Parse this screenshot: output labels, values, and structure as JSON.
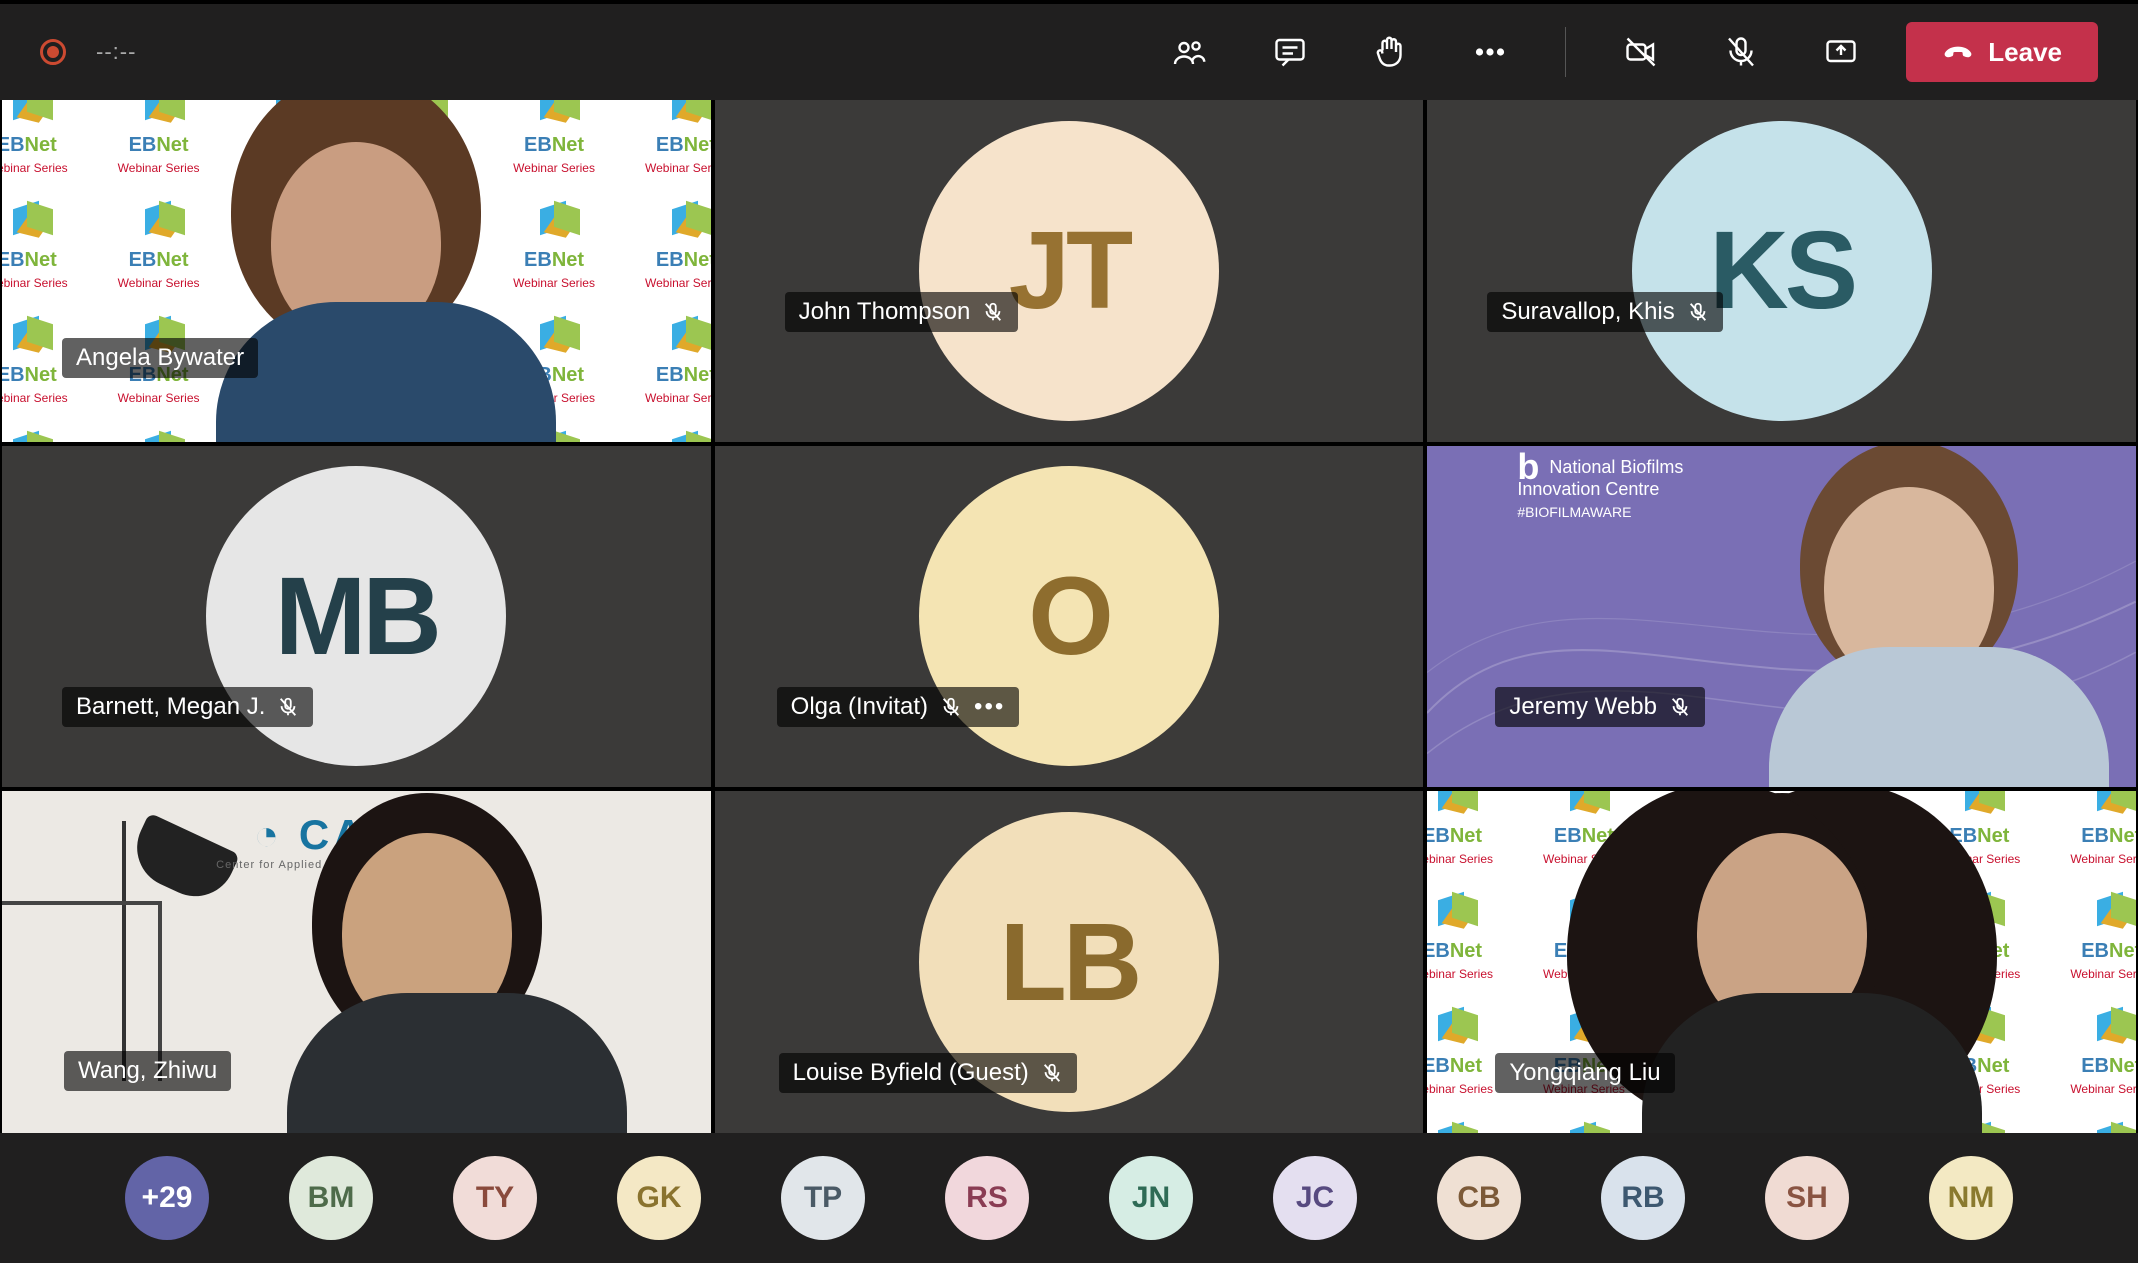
{
  "topbar": {
    "timer": "--:--",
    "leave_label": "Leave"
  },
  "participants": {
    "angela": {
      "name": "Angela Bywater",
      "muted": false
    },
    "john": {
      "name": "John Thompson",
      "muted": true,
      "initials": "JT",
      "avatar_bg": "#f6e3cb",
      "avatar_fg": "#977232"
    },
    "khis": {
      "name": "Suravallop, Khis",
      "muted": true,
      "initials": "KS",
      "avatar_bg": "#c5e2ea",
      "avatar_fg": "#2a5b64"
    },
    "megan": {
      "name": "Barnett, Megan J.",
      "muted": true,
      "initials": "MB",
      "avatar_bg": "#e6e6e6",
      "avatar_fg": "#24404a"
    },
    "olga": {
      "name": "Olga (Invitat)",
      "muted": true,
      "initials": "O",
      "avatar_bg": "#f4e4b3",
      "avatar_fg": "#8e6d2e",
      "show_dots": true
    },
    "jeremy": {
      "name": "Jeremy Webb",
      "muted": true
    },
    "zhiwu": {
      "name": "Wang, Zhiwu",
      "muted": false
    },
    "louise": {
      "name": "Louise Byfield (Guest)",
      "muted": true,
      "initials": "LB",
      "avatar_bg": "#f2dfba",
      "avatar_fg": "#8a6a2d"
    },
    "yongqiang": {
      "name": "Yongqiang Liu",
      "muted": false
    }
  },
  "overflow_count": "+29",
  "strip": [
    {
      "initials": "BM",
      "bg": "#dfe9db",
      "fg": "#4e6b4a"
    },
    {
      "initials": "TY",
      "bg": "#f1dcd8",
      "fg": "#8a4a3c"
    },
    {
      "initials": "GK",
      "bg": "#f4e8c5",
      "fg": "#8a732e"
    },
    {
      "initials": "TP",
      "bg": "#e1e6ea",
      "fg": "#4a5a66"
    },
    {
      "initials": "RS",
      "bg": "#f1d7dc",
      "fg": "#8a3c53"
    },
    {
      "initials": "JN",
      "bg": "#d6ede4",
      "fg": "#2e6b55"
    },
    {
      "initials": "JC",
      "bg": "#e4dff0",
      "fg": "#574a80"
    },
    {
      "initials": "CB",
      "bg": "#efe0d3",
      "fg": "#7c5a38"
    },
    {
      "initials": "RB",
      "bg": "#d9e2ec",
      "fg": "#3d5870"
    },
    {
      "initials": "SH",
      "bg": "#f0dbd3",
      "fg": "#8a5442"
    },
    {
      "initials": "NM",
      "bg": "#f3e9c3",
      "fg": "#8a7a2e"
    }
  ],
  "labels": {
    "ebnet": "EBNet",
    "ebnet_sub": "Webinar Series",
    "cawri": "CAWRI",
    "cawri_sub": "Center for Applied Water Research & Innovation",
    "nb_line1": "National Biofilms",
    "nb_line2": "Innovation Centre",
    "nb_line3": "#BIOFILMAWARE"
  }
}
